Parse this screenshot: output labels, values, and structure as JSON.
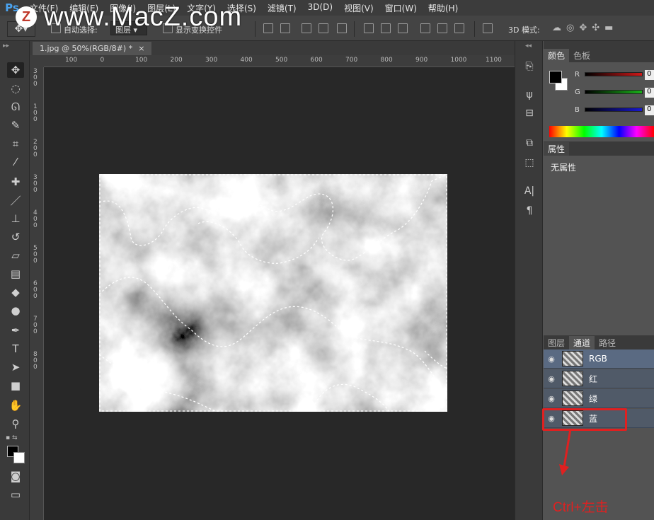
{
  "app_logo": "Ps",
  "menu": [
    "文件(F)",
    "编辑(E)",
    "图像(I)",
    "图层(L)",
    "文字(Y)",
    "选择(S)",
    "滤镜(T)",
    "3D(D)",
    "视图(V)",
    "窗口(W)",
    "帮助(H)"
  ],
  "watermark": {
    "letter": "Z",
    "text": "www.MacZ.com"
  },
  "options_bar": {
    "auto_select_label": "自动选择:",
    "auto_select_value": "图层",
    "show_transform_label": "显示变换控件",
    "mode_3d_label": "3D 模式:"
  },
  "document": {
    "tab_title": "1.jpg @ 50%(RGB/8#) *",
    "close_glyph": "×",
    "ruler_h_labels": [
      "100",
      "0",
      "100",
      "200",
      "300",
      "400",
      "500",
      "600",
      "700",
      "800",
      "900",
      "1000",
      "1100"
    ],
    "ruler_v_labels": [
      "300",
      "100",
      "200",
      "300",
      "400",
      "500",
      "600",
      "700",
      "800"
    ]
  },
  "panels": {
    "color_tabs": [
      "颜色",
      "色板"
    ],
    "color_channels": [
      {
        "label": "R",
        "value": "0",
        "color": "#d01818"
      },
      {
        "label": "G",
        "value": "0",
        "color": "#18b018"
      },
      {
        "label": "B",
        "value": "0",
        "color": "#1818d0"
      }
    ],
    "properties_tab": "属性",
    "properties_text": "无属性",
    "layer_tabs": [
      "图层",
      "通道",
      "路径"
    ],
    "channels": [
      "RGB",
      "红",
      "绿",
      "蓝"
    ]
  },
  "annotation": "Ctrl+左击"
}
